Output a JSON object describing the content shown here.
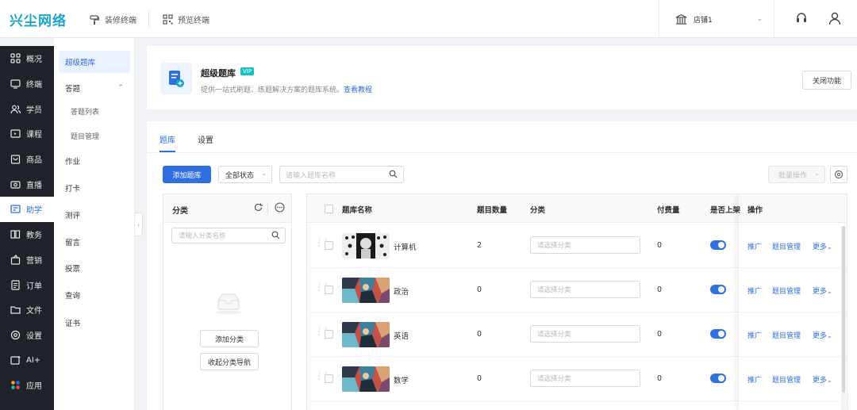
{
  "topbar": {
    "logo": "兴尘网络",
    "decorate_label": "装修终端",
    "preview_label": "预览终端",
    "store_label": "店铺1"
  },
  "main_nav": [
    {
      "label": "概况",
      "icon": "grid-icon",
      "active": false
    },
    {
      "label": "终端",
      "icon": "monitor-icon",
      "active": false
    },
    {
      "label": "学员",
      "icon": "users-icon",
      "active": false
    },
    {
      "label": "课程",
      "icon": "course-icon",
      "active": false
    },
    {
      "label": "商品",
      "icon": "product-icon",
      "active": false
    },
    {
      "label": "直播",
      "icon": "live-icon",
      "active": false
    },
    {
      "label": "助学",
      "icon": "study-icon",
      "active": true
    },
    {
      "label": "教务",
      "icon": "book-icon",
      "active": false
    },
    {
      "label": "营销",
      "icon": "marketing-icon",
      "active": false
    },
    {
      "label": "订单",
      "icon": "order-icon",
      "active": false
    },
    {
      "label": "文件",
      "icon": "folder-icon",
      "active": false
    },
    {
      "label": "设置",
      "icon": "settings-icon",
      "active": false
    },
    {
      "label": "AI+",
      "icon": "ai-icon",
      "active": false
    },
    {
      "label": "应用",
      "icon": "apps-icon",
      "active": false
    }
  ],
  "sub_nav": {
    "super_bank": "超级题库",
    "answer": "答题",
    "answer_list": "答题列表",
    "question_manage": "题目管理",
    "homework": "作业",
    "checkin": "打卡",
    "evaluation": "测评",
    "message": "留言",
    "vote": "投票",
    "inquiry": "查询",
    "certificate": "证书"
  },
  "feature": {
    "title": "超级题库",
    "badge": "VIP",
    "desc": "提供一站式刷题、练题解决方案的题库系统。",
    "tutorial_link": "查看教程",
    "close_label": "关闭功能"
  },
  "tabs": {
    "bank": "题库",
    "settings": "设置"
  },
  "toolbar": {
    "add_label": "添加题库",
    "status_value": "全部状态",
    "search_placeholder": "请输入题库名称",
    "batch_label": "批量操作"
  },
  "category": {
    "title": "分类",
    "search_placeholder": "请输入分类名称",
    "add_label": "添加分类",
    "collapse_label": "收起分类导航"
  },
  "table": {
    "headers": {
      "name": "题库名称",
      "count": "题目数量",
      "category": "分类",
      "paid": "付费量",
      "listed": "是否上架",
      "ops": "操作"
    },
    "category_placeholder": "请选择分类",
    "op_promote": "推广",
    "op_manage": "题目管理",
    "op_more": "更多",
    "rows": [
      {
        "name": "计算机",
        "count": "2",
        "paid": "0",
        "listed": true
      },
      {
        "name": "政治",
        "count": "0",
        "paid": "0",
        "listed": true
      },
      {
        "name": "英语",
        "count": "0",
        "paid": "0",
        "listed": true
      },
      {
        "name": "数学",
        "count": "0",
        "paid": "0",
        "listed": true
      }
    ]
  },
  "colors": {
    "accent": "#2f6fe0",
    "sidebar": "#1f2329",
    "logo": "#1aa5c8"
  }
}
